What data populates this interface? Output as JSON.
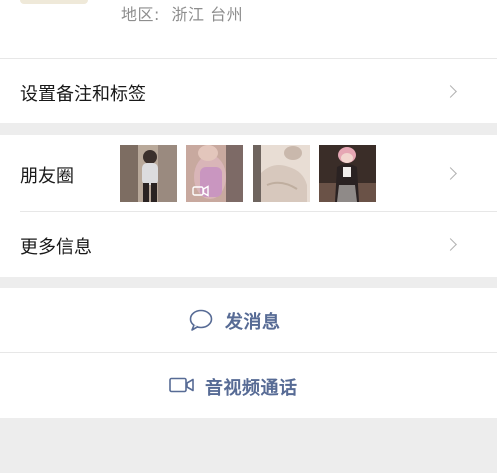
{
  "profile": {
    "region_label": "地区:",
    "region_value": "浙江  台州"
  },
  "rows": {
    "remark_tags": "设置备注和标签",
    "moments": "朋友圈",
    "more_info": "更多信息"
  },
  "moments_thumbnails": [
    {
      "icon": "photo-thumbnail-1"
    },
    {
      "icon": "video-thumbnail-2",
      "has_video_badge": true
    },
    {
      "icon": "photo-thumbnail-3"
    },
    {
      "icon": "photo-thumbnail-4"
    }
  ],
  "actions": {
    "message": "发消息",
    "call": "音视频通话"
  },
  "colors": {
    "background": "#ededed",
    "card": "#ffffff",
    "action_link": "#576b95",
    "secondary_text": "#8e8e8e"
  }
}
